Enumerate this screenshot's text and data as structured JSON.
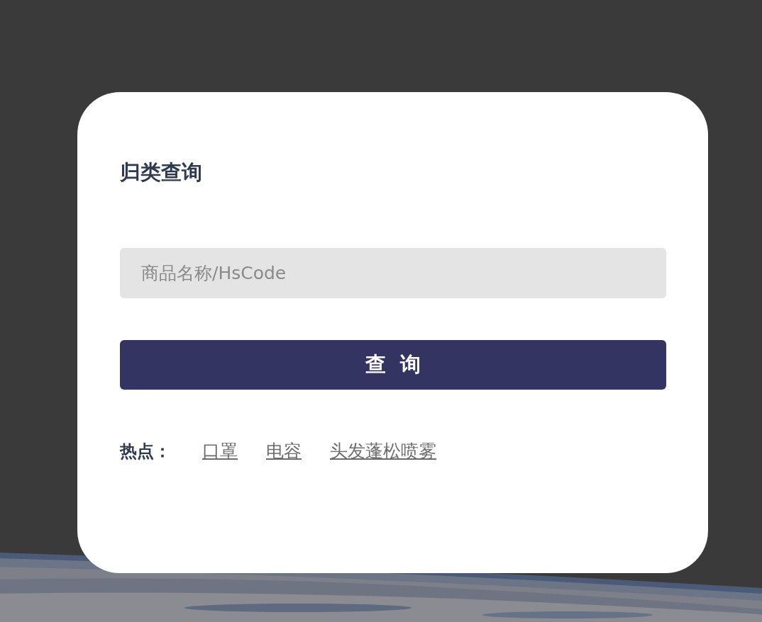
{
  "title": "归类查询",
  "search": {
    "placeholder": "商品名称/HsCode"
  },
  "submit_button": "查  询",
  "hot": {
    "label": "热点：",
    "links": [
      "口罩",
      "电容",
      "头发蓬松喷雾"
    ]
  }
}
